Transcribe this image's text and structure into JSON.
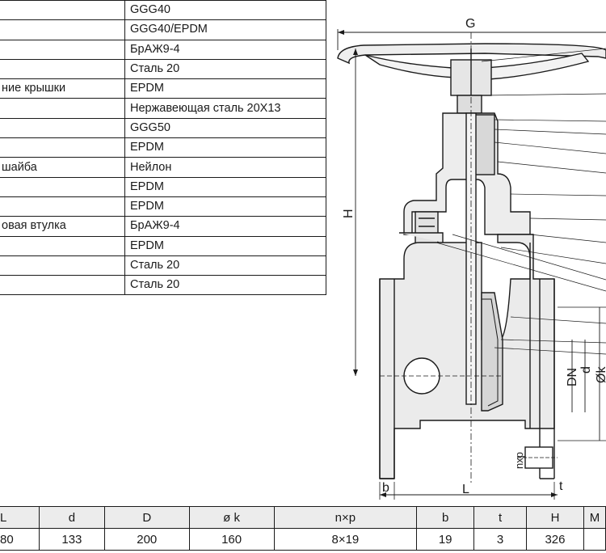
{
  "materials": [
    {
      "name": "",
      "material": "GGG40"
    },
    {
      "name": "",
      "material": "GGG40/EPDM"
    },
    {
      "name": "",
      "material": "БрАЖ9-4"
    },
    {
      "name": "",
      "material": "Сталь 20"
    },
    {
      "name": "ние крышки",
      "material": "EPDM"
    },
    {
      "name": "",
      "material": "Нержавеющая сталь 20Х13"
    },
    {
      "name": "",
      "material": "GGG50"
    },
    {
      "name": "",
      "material": "EPDM"
    },
    {
      "name": "шайба",
      "material": "Нейлон"
    },
    {
      "name": "",
      "material": "EPDM"
    },
    {
      "name": "",
      "material": "EPDM"
    },
    {
      "name": "овая втулка",
      "material": "БрАЖ9-4"
    },
    {
      "name": "",
      "material": "EPDM"
    },
    {
      "name": "",
      "material": "Сталь 20"
    },
    {
      "name": "",
      "material": "Сталь 20"
    }
  ],
  "drawing_labels": {
    "G": "G",
    "H": "H",
    "DN": "DN",
    "d": "d",
    "k": "Øk",
    "nxp": "nxp",
    "b": "b",
    "L": "L",
    "t": "t"
  },
  "dims": {
    "headers": [
      "L",
      "d",
      "D",
      "ø k",
      "n×p",
      "b",
      "t",
      "H",
      "M"
    ],
    "row": [
      "80",
      "133",
      "200",
      "160",
      "8×19",
      "19",
      "3",
      "326",
      ""
    ]
  },
  "colors": {
    "line": "#1a1a1a",
    "header_bg": "#ececec",
    "section_fill": "#e6e6e6"
  }
}
